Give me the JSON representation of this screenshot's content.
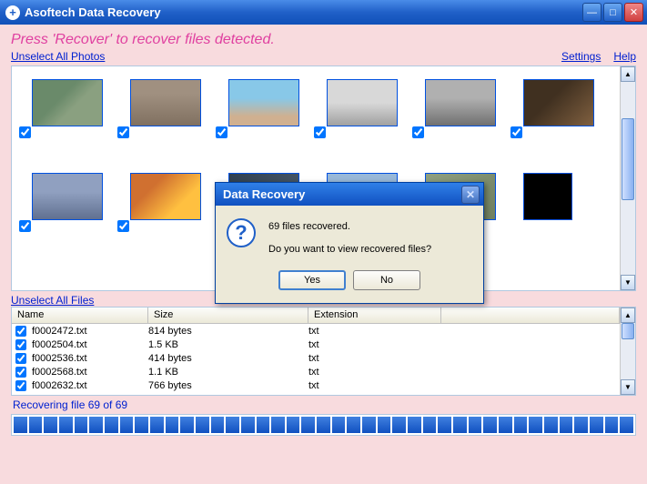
{
  "window": {
    "title": "Asoftech Data Recovery"
  },
  "instruction": "Press 'Recover' to recover files detected.",
  "links": {
    "unselect_photos": "Unselect All Photos",
    "unselect_files": "Unselect All Files",
    "settings": "Settings",
    "help": "Help"
  },
  "photos": [
    {
      "checked": true
    },
    {
      "checked": true
    },
    {
      "checked": true
    },
    {
      "checked": true
    },
    {
      "checked": true
    },
    {
      "checked": true
    },
    {
      "checked": true
    },
    {
      "checked": true
    },
    {
      "checked": true
    },
    {
      "checked": true
    },
    {
      "checked": true
    },
    {
      "checked": true
    }
  ],
  "files_table": {
    "headers": {
      "name": "Name",
      "size": "Size",
      "ext": "Extension"
    },
    "rows": [
      {
        "name": "f0002472.txt",
        "size": "814 bytes",
        "ext": "txt",
        "checked": true
      },
      {
        "name": "f0002504.txt",
        "size": "1.5 KB",
        "ext": "txt",
        "checked": true
      },
      {
        "name": "f0002536.txt",
        "size": "414 bytes",
        "ext": "txt",
        "checked": true
      },
      {
        "name": "f0002568.txt",
        "size": "1.1 KB",
        "ext": "txt",
        "checked": true
      },
      {
        "name": "f0002632.txt",
        "size": "766 bytes",
        "ext": "txt",
        "checked": true
      }
    ]
  },
  "status": "Recovering file 69 of 69",
  "progress_blocks": 41,
  "dialog": {
    "title": "Data Recovery",
    "line1": "69 files recovered.",
    "line2": "Do you want to view recovered files?",
    "yes": "Yes",
    "no": "No"
  }
}
